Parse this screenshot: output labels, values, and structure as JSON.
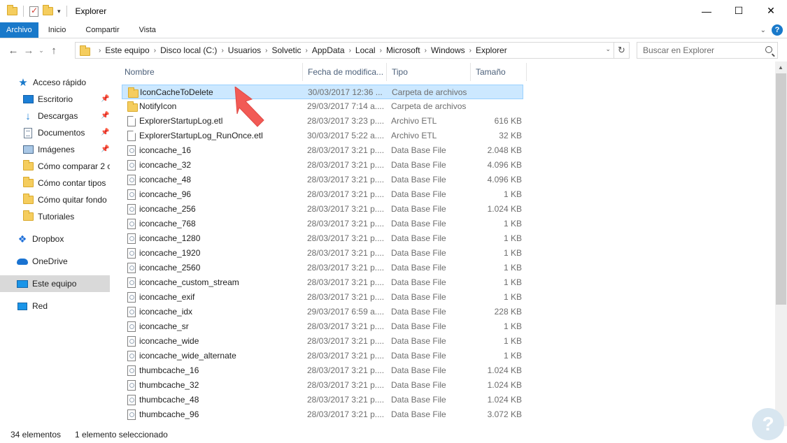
{
  "window": {
    "title": "Explorer",
    "controls": {
      "minimize": "—",
      "maximize": "☐",
      "close": "✕"
    }
  },
  "ribbon": {
    "tabs": [
      {
        "label": "Archivo",
        "active": true
      },
      {
        "label": "Inicio"
      },
      {
        "label": "Compartir"
      },
      {
        "label": "Vista"
      }
    ],
    "help_label": "?"
  },
  "address": {
    "breadcrumbs": [
      "Este equipo",
      "Disco local (C:)",
      "Usuarios",
      "Solvetic",
      "AppData",
      "Local",
      "Microsoft",
      "Windows",
      "Explorer"
    ]
  },
  "search": {
    "placeholder": "Buscar en Explorer"
  },
  "nav": {
    "quick_access": "Acceso rápido",
    "items": [
      {
        "label": "Escritorio",
        "icon": "desktop-icon",
        "pinned": true
      },
      {
        "label": "Descargas",
        "icon": "download-icon",
        "pinned": true
      },
      {
        "label": "Documentos",
        "icon": "documents-icon",
        "pinned": true
      },
      {
        "label": "Imágenes",
        "icon": "pictures-icon",
        "pinned": true
      },
      {
        "label": "Cómo comparar 2 c",
        "icon": "folder-icon"
      },
      {
        "label": "Cómo contar tipos",
        "icon": "folder-icon"
      },
      {
        "label": "Cómo quitar fondo",
        "icon": "folder-icon"
      },
      {
        "label": "Tutoriales",
        "icon": "folder-icon"
      }
    ],
    "dropbox": "Dropbox",
    "onedrive": "OneDrive",
    "this_pc": "Este equipo",
    "network": "Red"
  },
  "columns": {
    "name": "Nombre",
    "date": "Fecha de modifica...",
    "type": "Tipo",
    "size": "Tamaño"
  },
  "files": [
    {
      "name": "IconCacheToDelete",
      "date": "30/03/2017 12:36 ...",
      "type": "Carpeta de archivos",
      "size": "",
      "icon": "folder",
      "selected": true
    },
    {
      "name": "NotifyIcon",
      "date": "29/03/2017 7:14 a....",
      "type": "Carpeta de archivos",
      "size": "",
      "icon": "folder"
    },
    {
      "name": "ExplorerStartupLog.etl",
      "date": "28/03/2017 3:23 p....",
      "type": "Archivo ETL",
      "size": "616 KB",
      "icon": "file"
    },
    {
      "name": "ExplorerStartupLog_RunOnce.etl",
      "date": "30/03/2017 5:22 a....",
      "type": "Archivo ETL",
      "size": "32 KB",
      "icon": "file"
    },
    {
      "name": "iconcache_16",
      "date": "28/03/2017 3:21 p....",
      "type": "Data Base File",
      "size": "2.048 KB",
      "icon": "db"
    },
    {
      "name": "iconcache_32",
      "date": "28/03/2017 3:21 p....",
      "type": "Data Base File",
      "size": "4.096 KB",
      "icon": "db"
    },
    {
      "name": "iconcache_48",
      "date": "28/03/2017 3:21 p....",
      "type": "Data Base File",
      "size": "4.096 KB",
      "icon": "db"
    },
    {
      "name": "iconcache_96",
      "date": "28/03/2017 3:21 p....",
      "type": "Data Base File",
      "size": "1 KB",
      "icon": "db"
    },
    {
      "name": "iconcache_256",
      "date": "28/03/2017 3:21 p....",
      "type": "Data Base File",
      "size": "1.024 KB",
      "icon": "db"
    },
    {
      "name": "iconcache_768",
      "date": "28/03/2017 3:21 p....",
      "type": "Data Base File",
      "size": "1 KB",
      "icon": "db"
    },
    {
      "name": "iconcache_1280",
      "date": "28/03/2017 3:21 p....",
      "type": "Data Base File",
      "size": "1 KB",
      "icon": "db"
    },
    {
      "name": "iconcache_1920",
      "date": "28/03/2017 3:21 p....",
      "type": "Data Base File",
      "size": "1 KB",
      "icon": "db"
    },
    {
      "name": "iconcache_2560",
      "date": "28/03/2017 3:21 p....",
      "type": "Data Base File",
      "size": "1 KB",
      "icon": "db"
    },
    {
      "name": "iconcache_custom_stream",
      "date": "28/03/2017 3:21 p....",
      "type": "Data Base File",
      "size": "1 KB",
      "icon": "db"
    },
    {
      "name": "iconcache_exif",
      "date": "28/03/2017 3:21 p....",
      "type": "Data Base File",
      "size": "1 KB",
      "icon": "db"
    },
    {
      "name": "iconcache_idx",
      "date": "29/03/2017 6:59 a....",
      "type": "Data Base File",
      "size": "228 KB",
      "icon": "db"
    },
    {
      "name": "iconcache_sr",
      "date": "28/03/2017 3:21 p....",
      "type": "Data Base File",
      "size": "1 KB",
      "icon": "db"
    },
    {
      "name": "iconcache_wide",
      "date": "28/03/2017 3:21 p....",
      "type": "Data Base File",
      "size": "1 KB",
      "icon": "db"
    },
    {
      "name": "iconcache_wide_alternate",
      "date": "28/03/2017 3:21 p....",
      "type": "Data Base File",
      "size": "1 KB",
      "icon": "db"
    },
    {
      "name": "thumbcache_16",
      "date": "28/03/2017 3:21 p....",
      "type": "Data Base File",
      "size": "1.024 KB",
      "icon": "db"
    },
    {
      "name": "thumbcache_32",
      "date": "28/03/2017 3:21 p....",
      "type": "Data Base File",
      "size": "1.024 KB",
      "icon": "db"
    },
    {
      "name": "thumbcache_48",
      "date": "28/03/2017 3:21 p....",
      "type": "Data Base File",
      "size": "1.024 KB",
      "icon": "db"
    },
    {
      "name": "thumbcache_96",
      "date": "28/03/2017 3:21 p....",
      "type": "Data Base File",
      "size": "3.072 KB",
      "icon": "db"
    }
  ],
  "status": {
    "count": "34 elementos",
    "selection": "1 elemento seleccionado"
  },
  "colors": {
    "accent": "#1979ca",
    "selection_bg": "#cce8ff",
    "selection_border": "#99d1ff",
    "arrow": "#f25a55"
  }
}
